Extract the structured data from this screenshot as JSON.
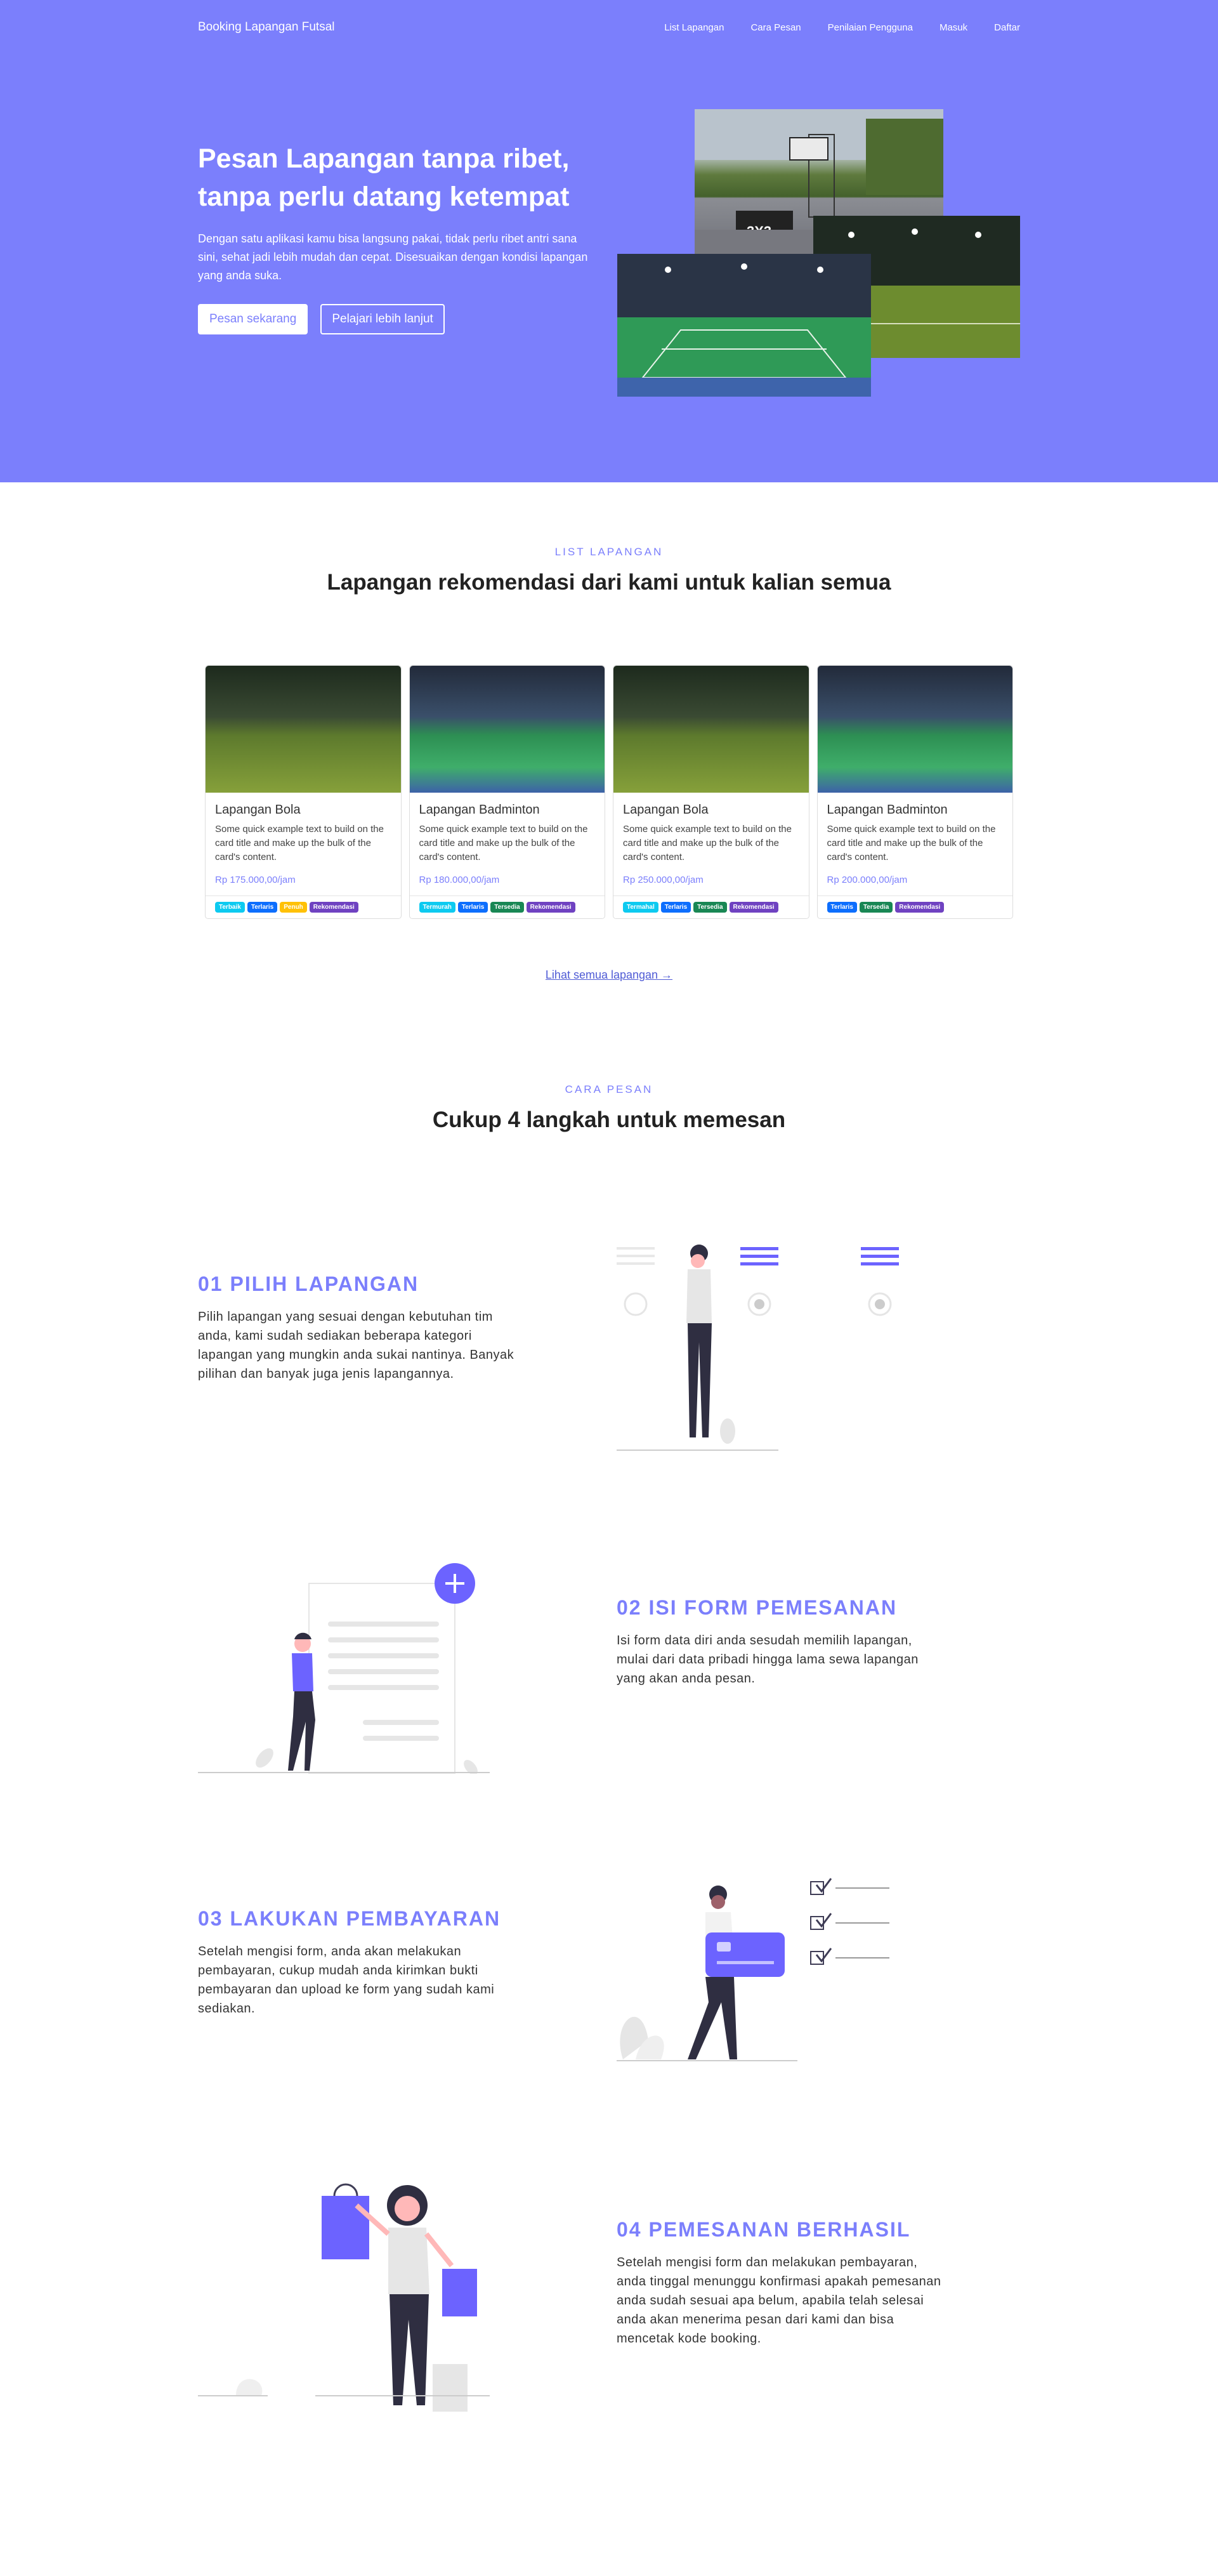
{
  "nav": {
    "brand": "Booking Lapangan Futsal",
    "links": [
      "List Lapangan",
      "Cara Pesan",
      "Penilaian Pengguna",
      "Masuk",
      "Daftar"
    ]
  },
  "hero": {
    "title_line1": "Pesan Lapangan tanpa ribet,",
    "title_line2": "tanpa perlu datang ketempat",
    "description": "Dengan satu aplikasi kamu bisa langsung pakai, tidak perlu ribet antri sana sini, sehat jadi lebih mudah dan cepat. Disesuaikan dengan kondisi lapangan yang anda suka.",
    "btn_primary": "Pesan sekarang",
    "btn_secondary": "Pelajari lebih lanjut"
  },
  "list_section": {
    "eyebrow": "LIST LAPANGAN",
    "title": "Lapangan rekomendasi dari kami untuk kalian semua",
    "see_all": "Lihat semua lapangan →",
    "cards": [
      {
        "title": "Lapangan Bola",
        "text": "Some quick example text to build on the card title and make up the bulk of the card's content.",
        "price": "Rp 175.000,00/jam",
        "badges": [
          {
            "label": "Terbaik",
            "color": "#0dcaf0"
          },
          {
            "label": "Terlaris",
            "color": "#0d6efd"
          },
          {
            "label": "Penuh",
            "color": "#ffc107"
          },
          {
            "label": "Rekomendasi",
            "color": "#6f42c1"
          }
        ]
      },
      {
        "title": "Lapangan Badminton",
        "text": "Some quick example text to build on the card title and make up the bulk of the card's content.",
        "price": "Rp 180.000,00/jam",
        "badges": [
          {
            "label": "Termurah",
            "color": "#0dcaf0"
          },
          {
            "label": "Terlaris",
            "color": "#0d6efd"
          },
          {
            "label": "Tersedia",
            "color": "#198754"
          },
          {
            "label": "Rekomendasi",
            "color": "#6f42c1"
          }
        ]
      },
      {
        "title": "Lapangan Bola",
        "text": "Some quick example text to build on the card title and make up the bulk of the card's content.",
        "price": "Rp 250.000,00/jam",
        "badges": [
          {
            "label": "Termahal",
            "color": "#0dcaf0"
          },
          {
            "label": "Terlaris",
            "color": "#0d6efd"
          },
          {
            "label": "Tersedia",
            "color": "#198754"
          },
          {
            "label": "Rekomendasi",
            "color": "#6f42c1"
          }
        ]
      },
      {
        "title": "Lapangan Badminton",
        "text": "Some quick example text to build on the card title and make up the bulk of the card's content.",
        "price": "Rp 200.000,00/jam",
        "badges": [
          {
            "label": "Terlaris",
            "color": "#0d6efd"
          },
          {
            "label": "Tersedia",
            "color": "#198754"
          },
          {
            "label": "Rekomendasi",
            "color": "#6f42c1"
          }
        ]
      }
    ]
  },
  "steps_section": {
    "eyebrow": "CARA PESAN",
    "title": "Cukup 4 langkah untuk memesan",
    "steps": [
      {
        "title": "01 PILIH LAPANGAN",
        "desc": "Pilih lapangan yang sesuai dengan kebutuhan tim anda, kami sudah sediakan beberapa kategori lapangan yang mungkin anda sukai nantinya. Banyak pilihan dan banyak juga jenis lapangannya.",
        "illustration": "woman-choosing-icon"
      },
      {
        "title": "02 ISI FORM PEMESANAN",
        "desc": "Isi form data diri anda sesudah memilih lapangan, mulai dari data pribadi hingga lama sewa lapangan yang akan anda pesan.",
        "illustration": "form-filling-icon"
      },
      {
        "title": "03 LAKUKAN PEMBAYARAN",
        "desc": "Setelah mengisi form, anda akan melakukan pembayaran, cukup mudah anda kirimkan bukti pembayaran dan upload ke form yang sudah kami sediakan.",
        "illustration": "card-payment-icon"
      },
      {
        "title": "04 PEMESANAN BERHASIL",
        "desc": "Setelah mengisi form dan melakukan pembayaran, anda tinggal menunggu konfirmasi apakah pemesanan anda sudah sesuai apa belum, apabila telah selesai anda akan menerima pesan dari kami dan bisa mencetak kode booking.",
        "illustration": "shopping-success-icon"
      }
    ]
  },
  "colors": {
    "accent": "#7b7ffc",
    "link": "#4f5bd5"
  }
}
